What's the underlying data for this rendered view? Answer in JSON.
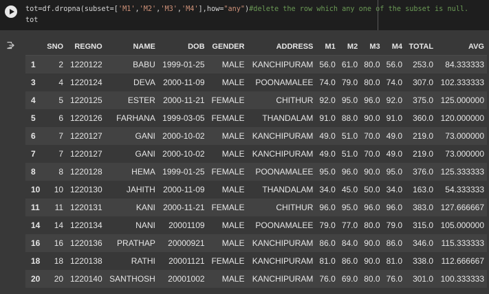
{
  "code_cell": {
    "lines": [
      [
        {
          "t": "tot=df.dropna(subset=[",
          "c": "plain"
        },
        {
          "t": "'M1'",
          "c": "str"
        },
        {
          "t": ",",
          "c": "plain"
        },
        {
          "t": "'M2'",
          "c": "str"
        },
        {
          "t": ",",
          "c": "plain"
        },
        {
          "t": "'M3'",
          "c": "str"
        },
        {
          "t": ",",
          "c": "plain"
        },
        {
          "t": "'M4'",
          "c": "str"
        },
        {
          "t": "],how=",
          "c": "plain"
        },
        {
          "t": "\"any\"",
          "c": "str"
        },
        {
          "t": ")",
          "c": "plain"
        },
        {
          "t": "#delete the row which any one of the subset is null.",
          "c": "comment"
        }
      ],
      [
        {
          "t": "tot",
          "c": "plain"
        }
      ]
    ]
  },
  "icons": {
    "run": "play-icon",
    "output": "output-redirect-icon"
  },
  "table": {
    "columns": [
      "",
      "SNO",
      "REGNO",
      "NAME",
      "DOB",
      "GENDER",
      "ADDRESS",
      "M1",
      "M2",
      "M3",
      "M4",
      "TOTAL",
      "AVG"
    ],
    "rows": [
      [
        "1",
        "2",
        "1220122",
        "BABU",
        "1999-01-25",
        "MALE",
        "KANCHIPURAM",
        "56.0",
        "61.0",
        "80.0",
        "56.0",
        "253.0",
        "84.333333"
      ],
      [
        "3",
        "4",
        "1220124",
        "DEVA",
        "2000-11-09",
        "MALE",
        "POONAMALEE",
        "74.0",
        "79.0",
        "80.0",
        "74.0",
        "307.0",
        "102.333333"
      ],
      [
        "4",
        "5",
        "1220125",
        "ESTER",
        "2000-11-21",
        "FEMALE",
        "CHITHUR",
        "92.0",
        "95.0",
        "96.0",
        "92.0",
        "375.0",
        "125.000000"
      ],
      [
        "5",
        "6",
        "1220126",
        "FARHANA",
        "1999-03-05",
        "FEMALE",
        "THANDALAM",
        "91.0",
        "88.0",
        "90.0",
        "91.0",
        "360.0",
        "120.000000"
      ],
      [
        "6",
        "7",
        "1220127",
        "GANI",
        "2000-10-02",
        "MALE",
        "KANCHIPURAM",
        "49.0",
        "51.0",
        "70.0",
        "49.0",
        "219.0",
        "73.000000"
      ],
      [
        "7",
        "7",
        "1220127",
        "GANI",
        "2000-10-02",
        "MALE",
        "KANCHIPURAM",
        "49.0",
        "51.0",
        "70.0",
        "49.0",
        "219.0",
        "73.000000"
      ],
      [
        "8",
        "8",
        "1220128",
        "HEMA",
        "1999-01-25",
        "FEMALE",
        "POONAMALEE",
        "95.0",
        "96.0",
        "90.0",
        "95.0",
        "376.0",
        "125.333333"
      ],
      [
        "10",
        "10",
        "1220130",
        "JAHITH",
        "2000-11-09",
        "MALE",
        "THANDALAM",
        "34.0",
        "45.0",
        "50.0",
        "34.0",
        "163.0",
        "54.333333"
      ],
      [
        "11",
        "11",
        "1220131",
        "KANI",
        "2000-11-21",
        "FEMALE",
        "CHITHUR",
        "96.0",
        "95.0",
        "96.0",
        "96.0",
        "383.0",
        "127.666667"
      ],
      [
        "14",
        "14",
        "1220134",
        "NANI",
        "20001109",
        "MALE",
        "POONAMALEE",
        "79.0",
        "77.0",
        "80.0",
        "79.0",
        "315.0",
        "105.000000"
      ],
      [
        "16",
        "16",
        "1220136",
        "PRATHAP",
        "20000921",
        "MALE",
        "KANCHIPURAM",
        "86.0",
        "84.0",
        "90.0",
        "86.0",
        "346.0",
        "115.333333"
      ],
      [
        "18",
        "18",
        "1220138",
        "RATHI",
        "20001121",
        "FEMALE",
        "KANCHIPURAM",
        "81.0",
        "86.0",
        "90.0",
        "81.0",
        "338.0",
        "112.666667"
      ],
      [
        "20",
        "20",
        "1220140",
        "SANTHOSH",
        "20001002",
        "MALE",
        "KANCHIPURAM",
        "76.0",
        "69.0",
        "80.0",
        "76.0",
        "301.0",
        "100.333333"
      ]
    ]
  },
  "colors": {
    "background": "#383838",
    "code_background": "#1e1e1e",
    "string": "#ce9178",
    "comment": "#6a9955",
    "row_odd": "#424242",
    "row_even": "#383838"
  }
}
